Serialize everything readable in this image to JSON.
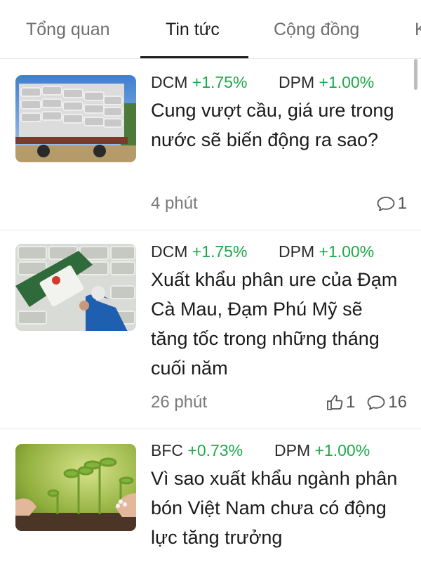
{
  "tabs": [
    {
      "label": "Tổng quan"
    },
    {
      "label": "Tin tức"
    },
    {
      "label": "Cộng đồng"
    },
    {
      "label": "K"
    }
  ],
  "active_tab": "Tin tức",
  "colors": {
    "positive": "#1ea94a",
    "text": "#1a1a1a",
    "muted": "#7a7a7a"
  },
  "articles": [
    {
      "tickers": [
        {
          "code": "DCM",
          "change": "+1.75%"
        },
        {
          "code": "DPM",
          "change": "+1.00%"
        }
      ],
      "title": "Cung vượt cầu, giá ure trong nước sẽ biến động ra sao?",
      "time": "4 phút",
      "likes": "",
      "comments": "1",
      "image": "fertilizer-bags-truck"
    },
    {
      "tickers": [
        {
          "code": "DCM",
          "change": "+1.75%"
        },
        {
          "code": "DPM",
          "change": "+1.00%"
        }
      ],
      "title": "Xuất khẩu phân ure của Đạm Cà Mau, Đạm Phú Mỹ sẽ tăng tốc trong những tháng cuối năm",
      "time": "26 phút",
      "likes": "1",
      "comments": "16",
      "image": "worker-loading-bags"
    },
    {
      "tickers": [
        {
          "code": "BFC",
          "change": "+0.73%"
        },
        {
          "code": "DPM",
          "change": "+1.00%"
        }
      ],
      "title": "Vì sao xuất khẩu ngành phân bón Việt Nam chưa có động lực tăng trưởng",
      "time": "",
      "likes": "",
      "comments": "",
      "image": "seedlings-hands"
    }
  ]
}
